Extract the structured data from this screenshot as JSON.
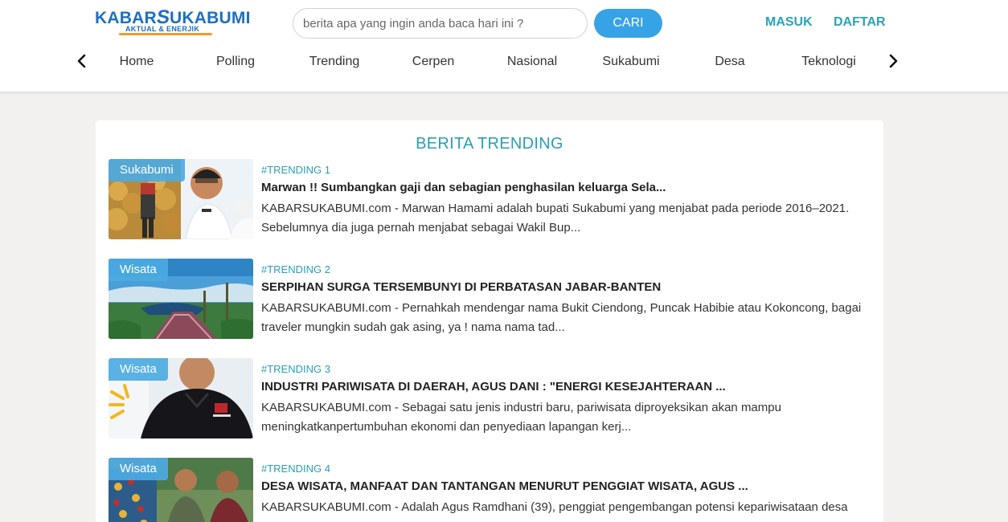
{
  "brand": {
    "logo_text": "KABAR SUKABUMI",
    "tagline": "AKTUAL & ENERJIK"
  },
  "search": {
    "placeholder": "berita apa yang ingin anda baca hari ini ?",
    "button_label": "CARI"
  },
  "auth": {
    "login_label": "MASUK",
    "register_label": "DAFTAR"
  },
  "nav": {
    "items": [
      "Home",
      "Polling",
      "Trending",
      "Cerpen",
      "Nasional",
      "Sukabumi",
      "Desa",
      "Teknologi"
    ]
  },
  "icons": {
    "prev": "chevron-left-icon",
    "next": "chevron-right-icon"
  },
  "colors": {
    "accent": "#2a9fb4",
    "button": "#36a3e6",
    "badge": "#4caae2",
    "brand": "#1d6fc0"
  },
  "section": {
    "title": "BERITA TRENDING"
  },
  "articles": [
    {
      "category": "Sukabumi",
      "rank_label": "#TRENDING 1",
      "title": "Marwan !! Sumbangkan gaji dan sebagian penghasilan keluarga Sela...",
      "excerpt": "KABARSUKABUMI.com - Marwan Hamami adalah bupati Sukabumi yang menjabat pada periode 2016–2021. Sebelumnya dia juga pernah menjabat sebagai Wakil Bup..."
    },
    {
      "category": "Wisata",
      "rank_label": "#TRENDING 2",
      "title": "SERPIHAN SURGA TERSEMBUNYI DI PERBATASAN JABAR-BANTEN",
      "excerpt": "KABARSUKABUMI.com - Pernahkah mendengar nama Bukit Ciendong, Puncak Habibie atau Kokoncong, bagai traveler mungkin sudah gak asing, ya ! nama nama tad..."
    },
    {
      "category": "Wisata",
      "rank_label": "#TRENDING 3",
      "title": "INDUSTRI PARIWISATA DI DAERAH, AGUS DANI : \"ENERGI KESEJAHTERAAN ...",
      "excerpt": "KABARSUKABUMI.com - Sebagai satu jenis industri baru, pariwisata diproyeksikan akan mampu meningkatkanpertumbuhan ekonomi dan penyediaan lapangan kerj..."
    },
    {
      "category": "Wisata",
      "rank_label": "#TRENDING 4",
      "title": "DESA WISATA, MANFAAT DAN TANTANGAN MENURUT PENGGIAT WISATA, AGUS ...",
      "excerpt": "KABARSUKABUMI.com - Adalah Agus Ramdhani (39), penggiat pengembangan potensi kepariwisataan desa"
    }
  ]
}
